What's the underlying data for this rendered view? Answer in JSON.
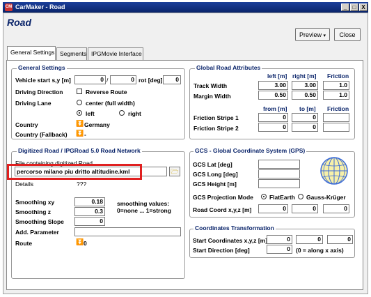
{
  "window": {
    "title": "CarMaker - Road",
    "logo": "CM",
    "controls": [
      "_",
      "□",
      "X"
    ]
  },
  "header": {
    "title": "Road",
    "preview_label": "Preview",
    "close_label": "Close"
  },
  "tabs": [
    "General Settings",
    "Segments",
    "IPGMovie Interface"
  ],
  "general_settings": {
    "title": "General Settings",
    "vehicle_start_label": "Vehicle start s,y [m]",
    "vehicle_start_s": "0",
    "slash": "/",
    "vehicle_start_y": "0",
    "rot_label": "rot [deg]",
    "rot_value": "0",
    "driving_direction_label": "Driving Direction",
    "reverse_route_label": "Reverse Route",
    "driving_lane_label": "Driving Lane",
    "lane_options": [
      "center (full width)",
      "left",
      "right"
    ],
    "lane_selected": "left",
    "country_label": "Country",
    "country_value": "Germany",
    "country_fallback_label": "Country (Fallback)",
    "country_fallback_value": "-"
  },
  "global_road": {
    "title": "Global Road Attributes",
    "headers": [
      "left [m]",
      "right [m]",
      "Friction"
    ],
    "rows": [
      {
        "label": "Track Width",
        "left": "3.00",
        "right": "3.00",
        "friction": "1.0"
      },
      {
        "label": "Margin Width",
        "left": "0.50",
        "right": "0.50",
        "friction": "1.0"
      }
    ],
    "stripe_headers": [
      "from [m]",
      "to [m]",
      "Friction"
    ],
    "stripes": [
      {
        "label": "Friction Stripe 1",
        "from": "0",
        "to": "0",
        "friction": ""
      },
      {
        "label": "Friction Stripe 2",
        "from": "0",
        "to": "0",
        "friction": ""
      }
    ]
  },
  "digitized": {
    "title": "Digitized Road / IPGRoad 5.0 Road Network",
    "file_label": "File containing digitized Road",
    "file_value": "percorso milano piu dritto altitudine.kml",
    "details_label": "Details",
    "details_value": "???",
    "smoothing_xy_label": "Smoothing xy",
    "smoothing_xy_value": "0.18",
    "smoothing_z_label": "Smoothing z",
    "smoothing_z_value": "0.3",
    "smoothing_slope_label": "Smoothing Slope",
    "smoothing_slope_value": "0",
    "smoothing_note_1": "smoothing values:",
    "smoothing_note_2": "0=none ... 1=strong",
    "add_param_label": "Add. Parameter",
    "add_param_value": "",
    "route_label": "Route",
    "route_value": "0"
  },
  "gcs": {
    "title": "GCS - Global Coordinate System (GPS)",
    "lat_label": "GCS Lat [deg]",
    "long_label": "GCS Long [deg]",
    "height_label": "GCS Height [m]",
    "projection_label": "GCS Projection Mode",
    "projection_options": [
      "FlatEarth",
      "Gauss-Krüger"
    ],
    "projection_selected": "FlatEarth",
    "road_coord_label": "Road Coord x,y,z [m]",
    "road_coord_values": [
      "0",
      "0",
      "0"
    ]
  },
  "transform": {
    "title": "Coordinates Transformation",
    "start_coords_label": "Start Coordinates x,y,z [m]",
    "start_coords_values": [
      "0",
      "0",
      "0"
    ],
    "start_dir_label": "Start Direction [deg]",
    "start_dir_value": "0",
    "start_dir_note": "(0 = along x axis)"
  },
  "colors": {
    "title_bar": "#0a246a",
    "group_title": "#0a246a",
    "highlight": "#e02020"
  }
}
